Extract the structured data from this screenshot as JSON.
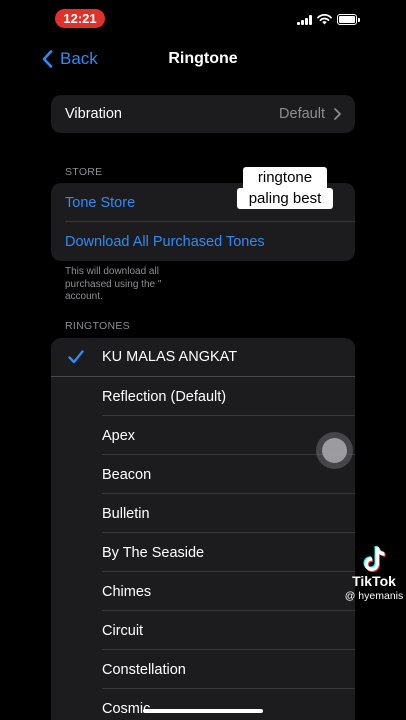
{
  "status_bar": {
    "time": "12:21"
  },
  "nav": {
    "back_label": "Back",
    "title": "Ringtone"
  },
  "vibration": {
    "label": "Vibration",
    "value": "Default"
  },
  "store": {
    "header": "STORE",
    "tone_store": "Tone Store",
    "download_all": "Download All Purchased Tones",
    "footnote_lines": [
      "This will download all",
      "purchased using the \"",
      "account."
    ]
  },
  "overlay": {
    "line1": "ringtone",
    "line2": "paling best"
  },
  "ringtones": {
    "header": "RINGTONES",
    "items": [
      {
        "label": "KU MALAS ANGKAT",
        "selected": true
      },
      {
        "label": "Reflection (Default)"
      },
      {
        "label": "Apex"
      },
      {
        "label": "Beacon"
      },
      {
        "label": "Bulletin"
      },
      {
        "label": "By The Seaside"
      },
      {
        "label": "Chimes"
      },
      {
        "label": "Circuit"
      },
      {
        "label": "Constellation"
      },
      {
        "label": "Cosmic"
      }
    ]
  },
  "watermark": {
    "brand": "TikTok",
    "user": "@ hyemanis"
  },
  "colors": {
    "accent": "#2e8bf5",
    "cell": "#1c1c1e",
    "time_pill": "#e0312b"
  }
}
